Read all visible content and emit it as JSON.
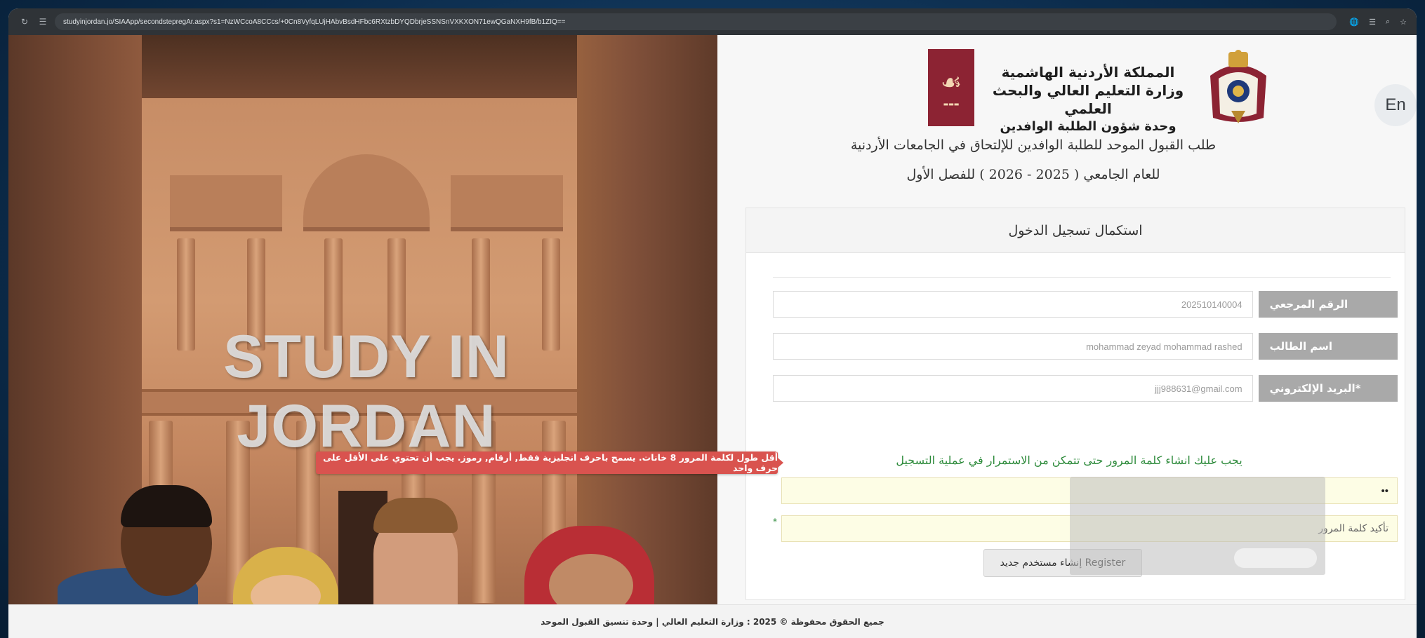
{
  "browser": {
    "url": "studyinjordan.jo/SIAApp/secondstepregAr.aspx?s1=NzWCcoA8CCcs/+0Cn8VyfqLUjHAbvBsdHFbc6RXtzbDYQDbrjeSSNSnVXKXON71ewQGaNXH9fB/b1ZIQ=="
  },
  "hero": {
    "title": "STUDY IN JORDAN"
  },
  "header": {
    "lang_button": "En",
    "ministry_line1": "المملكة الأردنية الهاشمية",
    "ministry_line2": "وزارة التعليم العالي والبحث العلمي",
    "ministry_line3": "وحدة شؤون الطلبة الوافدين",
    "heading_line1": "طلب القبول الموحد للطلبة الوافدين للإلتحاق في الجامعات الأردنية",
    "heading_line2": "للعام الجامعي ( 2025 - 2026 ) للفصل الأول"
  },
  "form": {
    "card_title": "استكمال تسجيل الدخول",
    "reference_label": "الرقم المرجعي",
    "reference_value": "202510140004",
    "student_name_label": "اسم الطالب",
    "student_name_value": "mohammad zeyad mohammad rashed",
    "email_label": "*البريد الإلكتروني",
    "email_value": "jjj988631@gmail.com",
    "notice": "يجب عليك انشاء كلمة المرور حتى تتمكن من الاستمرار في عملية التسجيل",
    "password_value": "••",
    "confirm_password_placeholder": "تأكيد كلمة المرور",
    "register_button": "إنشاء مستخدم جديد Register",
    "password_tooltip": "أقل طول لكلمة المرور 8 خانات. يسمح باحرف انجليزية فقط, أرقام, رموز. يجب أن تحتوي على الأقل على حرف واحد"
  },
  "footer": {
    "text": "جميع الحقوق محفوظة © 2025 : وزارة التعليم العالي | وحدة تنسيق القبول الموحد"
  },
  "colors": {
    "label_gray": "#a9a9a9",
    "notice_green": "#2c8a3a",
    "tooltip_red": "#d9534f",
    "logo_maroon": "#8c2333"
  }
}
